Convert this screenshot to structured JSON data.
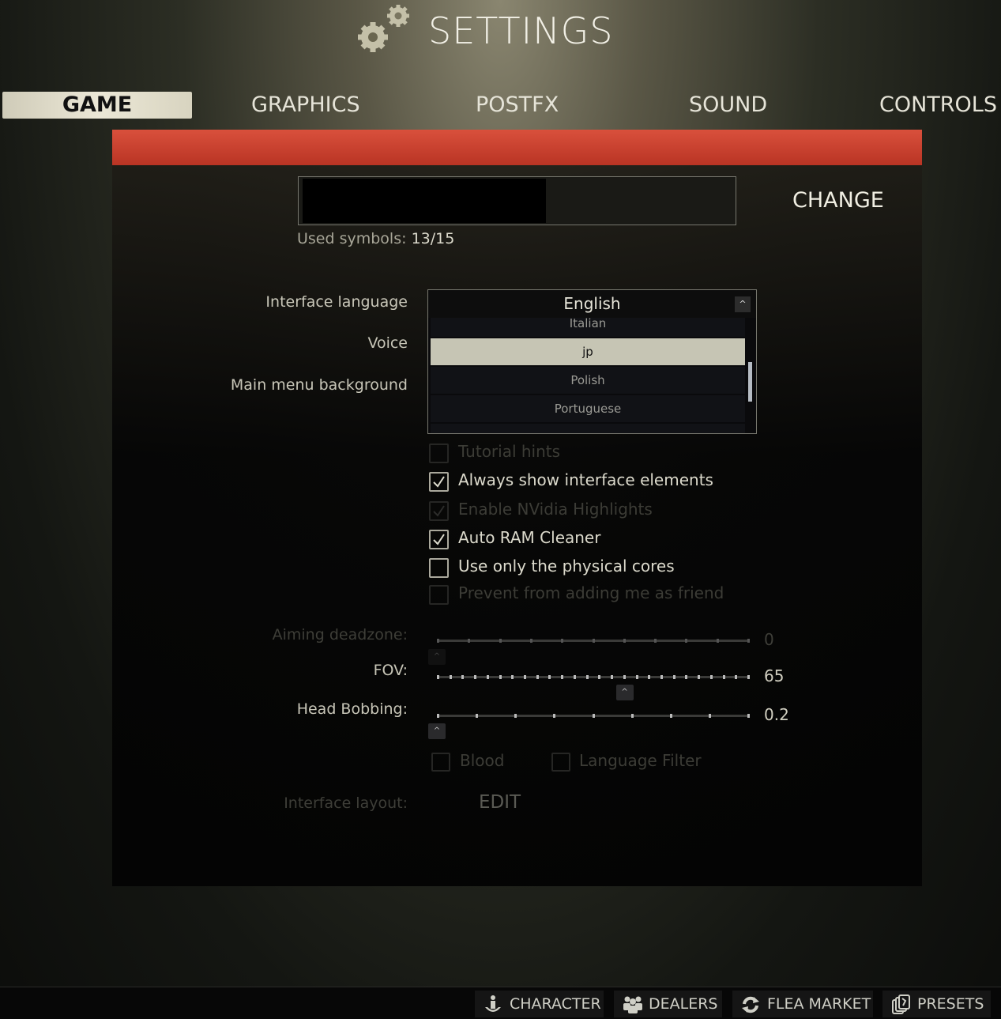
{
  "header": {
    "title": "SETTINGS",
    "icon": "gears-icon"
  },
  "tabs": [
    {
      "label": "GAME",
      "active": true
    },
    {
      "label": "GRAPHICS"
    },
    {
      "label": "POSTFX"
    },
    {
      "label": "SOUND"
    },
    {
      "label": "CONTROLS"
    }
  ],
  "accent_color": "#c8402e",
  "nickname": {
    "change_label": "CHANGE",
    "used_label": "Used symbols:",
    "used_value": "13/15"
  },
  "labels": {
    "interface_language": "Interface language",
    "voice": "Voice",
    "main_menu_background": "Main menu background",
    "aiming_deadzone": "Aiming deadzone:",
    "fov": "FOV:",
    "head_bobbing": "Head Bobbing:",
    "interface_layout": "Interface layout:"
  },
  "language_dropdown": {
    "selected": "English",
    "options": [
      {
        "label": "Italian"
      },
      {
        "label": "jp",
        "highlighted": true
      },
      {
        "label": "Polish"
      },
      {
        "label": "Portuguese"
      }
    ]
  },
  "checkboxes": [
    {
      "label": "Tutorial hints",
      "checked": false,
      "disabled": true
    },
    {
      "label": "Always show interface elements",
      "checked": true,
      "disabled": false
    },
    {
      "label": "Enable NVidia Highlights",
      "checked": true,
      "disabled": true
    },
    {
      "label": "Auto RAM Cleaner",
      "checked": true,
      "disabled": false
    },
    {
      "label": "Use only the physical cores",
      "checked": false,
      "disabled": false
    },
    {
      "label": "Prevent from adding me as friend",
      "checked": false,
      "disabled": true
    }
  ],
  "sliders": [
    {
      "name": "aiming-deadzone",
      "value": "0",
      "fraction": 0,
      "disabled": true
    },
    {
      "name": "fov",
      "value": "65",
      "fraction": 0.6
    },
    {
      "name": "head-bobbing",
      "value": "0.2",
      "fraction": 0
    }
  ],
  "options2": [
    {
      "label": "Blood",
      "checked": false,
      "disabled": true
    },
    {
      "label": "Language Filter",
      "checked": false,
      "disabled": true
    }
  ],
  "edit_label": "EDIT",
  "bottom_nav": [
    {
      "label": "CHARACTER",
      "icon": "character-icon"
    },
    {
      "label": "DEALERS",
      "icon": "dealers-icon"
    },
    {
      "label": "FLEA MARKET",
      "icon": "flea-market-icon"
    },
    {
      "label": "PRESETS",
      "icon": "presets-icon"
    }
  ]
}
